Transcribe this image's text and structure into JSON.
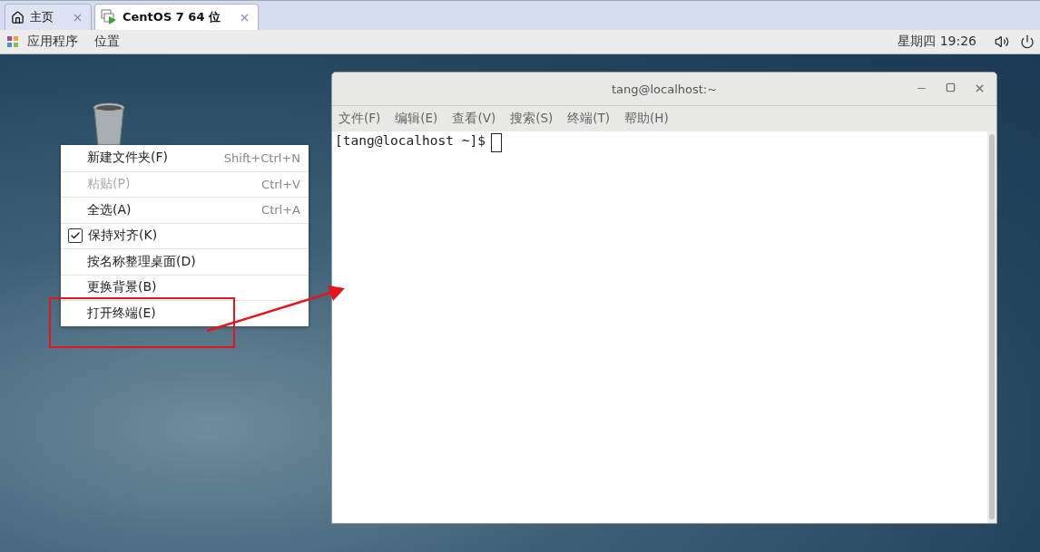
{
  "tabs": [
    {
      "label": "主页",
      "kind": "home",
      "selected": false
    },
    {
      "label": "CentOS 7 64 位",
      "kind": "machine",
      "selected": true
    }
  ],
  "top_panel": {
    "menus": [
      "应用程序",
      "位置"
    ],
    "clock": "星期四 19:26"
  },
  "context_menu": {
    "items": [
      {
        "label": "新建文件夹(F)",
        "shortcut": "Shift+Ctrl+N",
        "disabled": false,
        "checked": false
      },
      {
        "label": "粘贴(P)",
        "shortcut": "Ctrl+V",
        "disabled": true,
        "checked": false
      },
      {
        "label": "全选(A)",
        "shortcut": "Ctrl+A",
        "disabled": false,
        "checked": false
      },
      {
        "label": "保持对齐(K)",
        "disabled": false,
        "checked": true
      },
      {
        "label": "按名称整理桌面(D)",
        "disabled": false,
        "checked": false
      },
      {
        "label": "更换背景(B)",
        "disabled": false,
        "checked": false
      },
      {
        "label": "打开终端(E)",
        "disabled": false,
        "checked": false
      }
    ]
  },
  "terminal": {
    "title": "tang@localhost:~",
    "menus": [
      "文件(F)",
      "编辑(E)",
      "查看(V)",
      "搜索(S)",
      "终端(T)",
      "帮助(H)"
    ],
    "prompt": "[tang@localhost ~]$"
  }
}
